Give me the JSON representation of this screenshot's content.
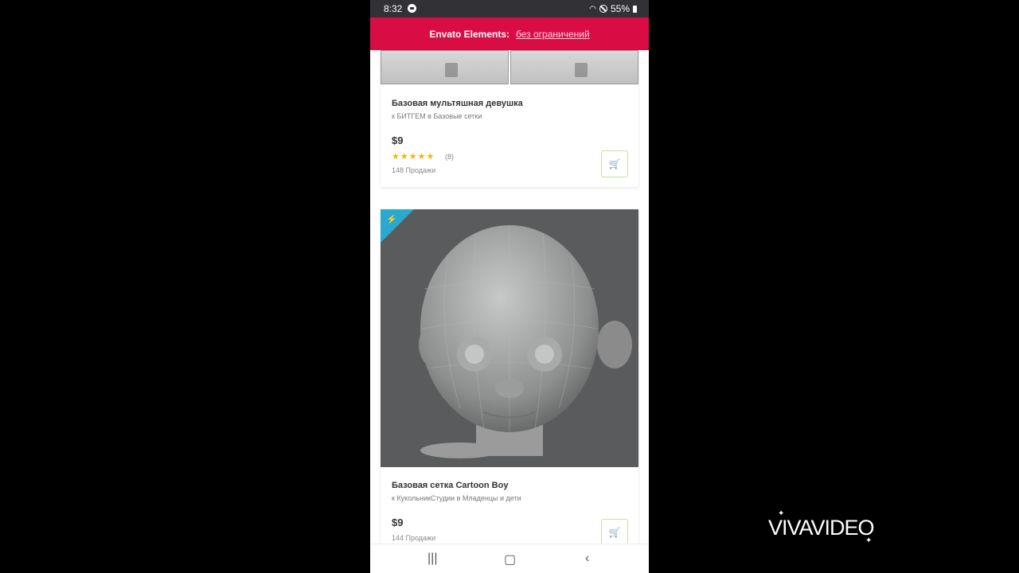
{
  "status_bar": {
    "time": "8:32",
    "battery": "55%"
  },
  "banner": {
    "brand": "Envato Elements:",
    "link": "без ограничений"
  },
  "products": [
    {
      "title": "Базовая мультяшная девушка",
      "author": "к БИТГЕМ в Базовые сетки",
      "price": "$9",
      "stars": "★★★★★",
      "rating": 4.5,
      "rating_count": "(8)",
      "sales": "148 Продажи"
    },
    {
      "title": "Базовая сетка Cartoon Boy",
      "author": "к КукольникСтудии в Младенцы и дети",
      "price": "$9",
      "sales": "144 Продажи"
    }
  ],
  "watermark": "VIVAVIDEO",
  "colors": {
    "banner": "#d90c44",
    "cart": "#82b540",
    "star": "#f5b400",
    "badge": "#2aa8cf"
  }
}
